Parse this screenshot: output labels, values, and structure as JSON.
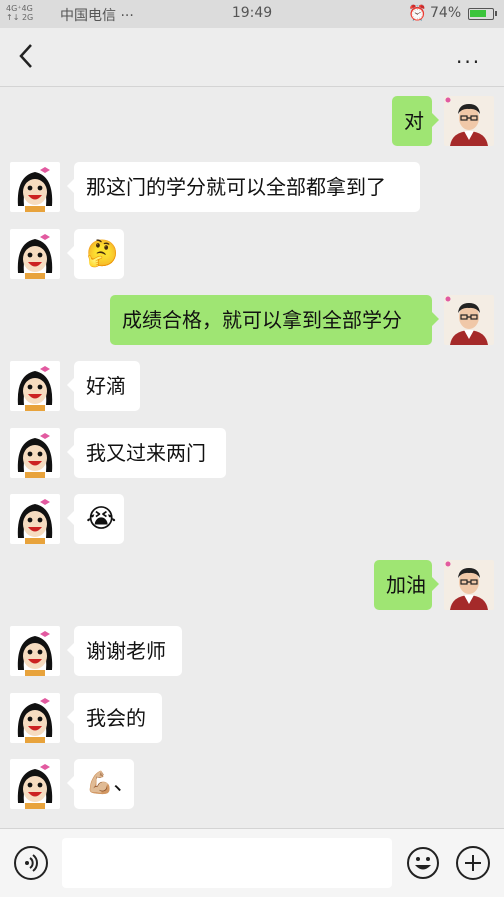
{
  "status_bar": {
    "signal": "4G⁺4G\n↑↓ 2G",
    "carrier": "中国电信 ···",
    "time": "19:49",
    "alarm_icon": "alarm-icon",
    "battery": "74%",
    "battery_level": 0.74
  },
  "header": {
    "back_icon": "back-arrow-icon",
    "title": "",
    "more_icon": "more-dots-icon",
    "more_label": "···"
  },
  "messages": [
    {
      "side": "right",
      "text": "对"
    },
    {
      "side": "left",
      "text": "那这门的学分就可以全部都拿到了"
    },
    {
      "side": "left",
      "text": "🤔"
    },
    {
      "side": "right",
      "text": "成绩合格，就可以拿到全部学分"
    },
    {
      "side": "left",
      "text": "好滴"
    },
    {
      "side": "left",
      "text": "我又过来两门"
    },
    {
      "side": "left",
      "text": "😭"
    },
    {
      "side": "right",
      "text": "加油"
    },
    {
      "side": "left",
      "text": "谢谢老师"
    },
    {
      "side": "left",
      "text": "我会的"
    },
    {
      "side": "left",
      "text": "💪🏼、"
    }
  ],
  "input_bar": {
    "voice_icon": "voice-icon",
    "input_placeholder": "",
    "emoji_icon": "emoji-icon",
    "plus_icon": "plus-icon"
  },
  "colors": {
    "sent_bubble": "#9fe573",
    "received_bubble": "#ffffff",
    "background": "#ececec"
  }
}
